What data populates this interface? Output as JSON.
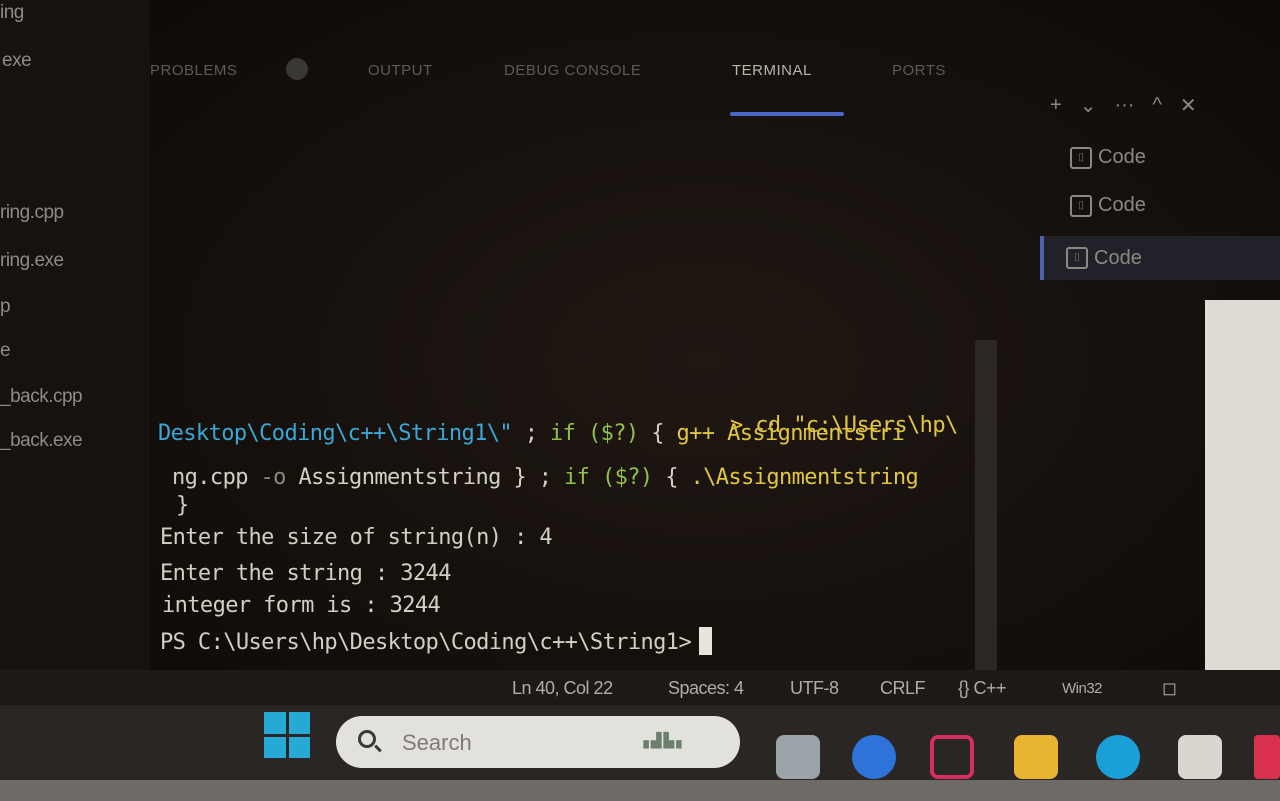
{
  "explorer": {
    "files": [
      "ring.cpp",
      "ring.exe",
      "p",
      "e",
      "_back.cpp",
      "_back.exe"
    ],
    "header_fragments": [
      "ing",
      "exe"
    ]
  },
  "panel": {
    "tabs": [
      {
        "label": "PROBLEMS",
        "active": false
      },
      {
        "label": "OUTPUT",
        "active": false
      },
      {
        "label": "DEBUG CONSOLE",
        "active": false
      },
      {
        "label": "TERMINAL",
        "active": true
      },
      {
        "label": "PORTS",
        "active": false
      }
    ],
    "actions": [
      "+",
      "⌄",
      "···",
      "^",
      "✕"
    ]
  },
  "terminals": [
    {
      "icon": "terminal-icon",
      "label": "Code",
      "active": false
    },
    {
      "icon": "terminal-icon",
      "label": "Code",
      "active": false
    },
    {
      "icon": "terminal-icon",
      "label": "Code",
      "active": true
    }
  ],
  "terminal": {
    "line1_prompt_tail": "> cd \"c:\\Users\\hp\\",
    "line2_path": "Desktop\\Coding\\c++\\String1\\\"",
    "line2_sep": " ; ",
    "line2_if": "if ($?)",
    "line2_brace": " { ",
    "line2_cmd": "g++ Assignmentstri",
    "line3_file": "ng.cpp",
    "line3_flag": " -o ",
    "line3_out": "Assignmentstring",
    "line3_close": " } ; ",
    "line3_if": "if ($?)",
    "line3_brace": " { ",
    "line3_run": ".\\Assignmentstring",
    "line4": "}",
    "line5": "Enter the size of string(n) : 4",
    "line6": "Enter the string : 3244",
    "line7": "integer form is : 3244",
    "line8_prompt": "PS C:\\Users\\hp\\Desktop\\Coding\\c++\\String1>"
  },
  "statusbar": {
    "position": "Ln 40, Col 22",
    "spaces": "Spaces: 4",
    "encoding": "UTF-8",
    "eol": "CRLF",
    "language": "{} C++",
    "platform": "Win32"
  },
  "taskbar": {
    "search_placeholder": "Search",
    "apps": [
      "task-view",
      "zoom",
      "mcafee",
      "file-explorer",
      "edge",
      "store"
    ]
  },
  "colors": {
    "path_blue": "#3ba6d8",
    "command_yellow": "#e0c640",
    "active_tab_underline": "#4a66c8",
    "windows_blue": "#27a9d6"
  }
}
